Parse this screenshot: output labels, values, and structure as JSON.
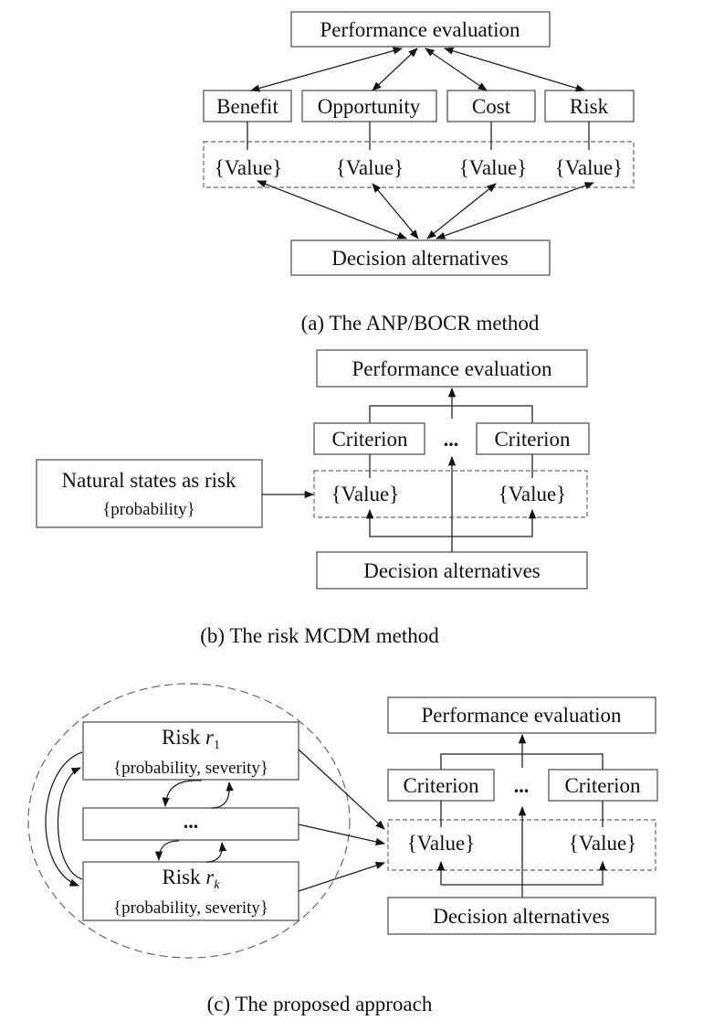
{
  "panel_a": {
    "top": "Performance evaluation",
    "criteria": [
      "Benefit",
      "Opportunity",
      "Cost",
      "Risk"
    ],
    "values": [
      "{Value}",
      "{Value}",
      "{Value}",
      "{Value}"
    ],
    "bottom": "Decision alternatives",
    "caption": "(a) The ANP/BOCR method"
  },
  "panel_b": {
    "top": "Performance evaluation",
    "criteria": [
      "Criterion",
      "Criterion"
    ],
    "ellipsis": "...",
    "values": [
      "{Value}",
      "{Value}"
    ],
    "risk_title": "Natural states as risk",
    "risk_sub": "{probability}",
    "bottom": "Decision alternatives",
    "caption": "(b) The risk MCDM method"
  },
  "panel_c": {
    "risks": [
      {
        "label": "Risk ",
        "var": "r",
        "sub": "1",
        "attrs": "{probability, severity}"
      },
      {
        "label": "Risk ",
        "var": "r",
        "sub": "k",
        "attrs": "{probability, severity}"
      }
    ],
    "middle": "...",
    "top": "Performance evaluation",
    "criteria": [
      "Criterion",
      "Criterion"
    ],
    "ellipsis": "...",
    "values": [
      "{Value}",
      "{Value}"
    ],
    "bottom": "Decision alternatives",
    "caption": "(c) The proposed approach"
  }
}
